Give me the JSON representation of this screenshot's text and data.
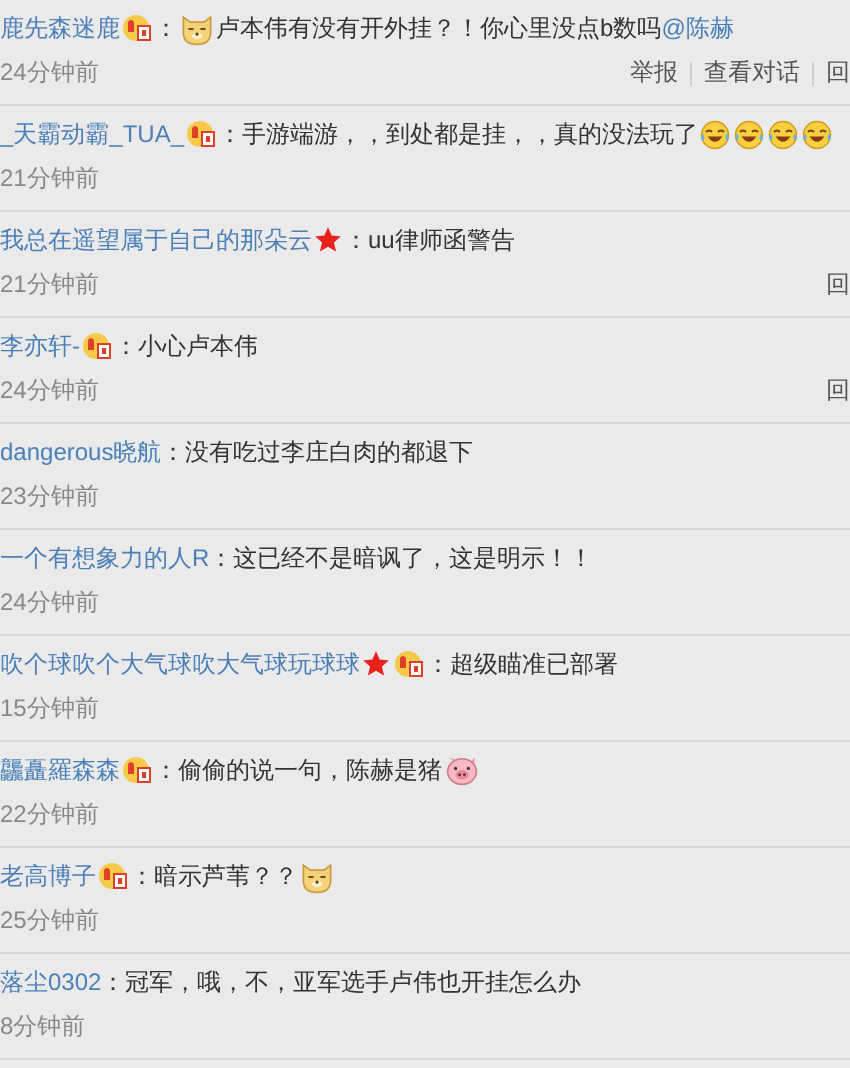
{
  "comments": [
    {
      "user": "鹿先森迷鹿",
      "badges": [
        {
          "kind": "vip"
        }
      ],
      "content": [
        {
          "kind": "text",
          "text": "："
        },
        {
          "kind": "dog"
        },
        {
          "kind": "text",
          "text": "卢本伟有没有开外挂？！你心里没点b数吗"
        },
        {
          "kind": "mention",
          "text": "@陈赫"
        }
      ],
      "time": "24分钟前",
      "actions": [
        "举报",
        "查看对话",
        "回"
      ]
    },
    {
      "user": "_天霸动霸_TUA_",
      "badges": [
        {
          "kind": "vip"
        }
      ],
      "content": [
        {
          "kind": "text",
          "text": "：手游端游，，到处都是挂，，真的没法玩了"
        },
        {
          "kind": "laugh"
        },
        {
          "kind": "laugh"
        },
        {
          "kind": "laugh"
        },
        {
          "kind": "laugh"
        }
      ],
      "time": "21分钟前"
    },
    {
      "user": "我总在遥望属于自己的那朵云",
      "badges": [
        {
          "kind": "star"
        }
      ],
      "content": [
        {
          "kind": "text",
          "text": "：uu律师函警告"
        }
      ],
      "time": "21分钟前",
      "actions": [
        "回"
      ]
    },
    {
      "user": "李亦轩-",
      "badges": [
        {
          "kind": "vip"
        }
      ],
      "content": [
        {
          "kind": "text",
          "text": "：小心卢本伟"
        }
      ],
      "time": "24分钟前",
      "actions": [
        "回"
      ]
    },
    {
      "user": "dangerous晓航",
      "content": [
        {
          "kind": "text",
          "text": "：没有吃过李庄白肉的都退下"
        }
      ],
      "time": "23分钟前"
    },
    {
      "user": "一个有想象力的人R",
      "content": [
        {
          "kind": "text",
          "text": "：这已经不是暗讽了，这是明示！！"
        }
      ],
      "time": "24分钟前"
    },
    {
      "user": "吹个球吹个大气球吹大气球玩球球",
      "badges": [
        {
          "kind": "star"
        },
        {
          "kind": "vip"
        }
      ],
      "content": [
        {
          "kind": "text",
          "text": "：超级瞄准已部署"
        }
      ],
      "time": "15分钟前"
    },
    {
      "user": "龘矗羅森森",
      "badges": [
        {
          "kind": "vip"
        }
      ],
      "content": [
        {
          "kind": "text",
          "text": "：偷偷的说一句，陈赫是猪"
        },
        {
          "kind": "pig"
        }
      ],
      "time": "22分钟前"
    },
    {
      "user": "老高博子",
      "badges": [
        {
          "kind": "vip"
        }
      ],
      "content": [
        {
          "kind": "text",
          "text": "：暗示芦苇？？"
        },
        {
          "kind": "dog"
        }
      ],
      "time": "25分钟前"
    },
    {
      "user": "落尘0302",
      "content": [
        {
          "kind": "text",
          "text": "：冠军，哦，不，亚军选手卢伟也开挂怎么办"
        }
      ],
      "time": "8分钟前"
    }
  ]
}
